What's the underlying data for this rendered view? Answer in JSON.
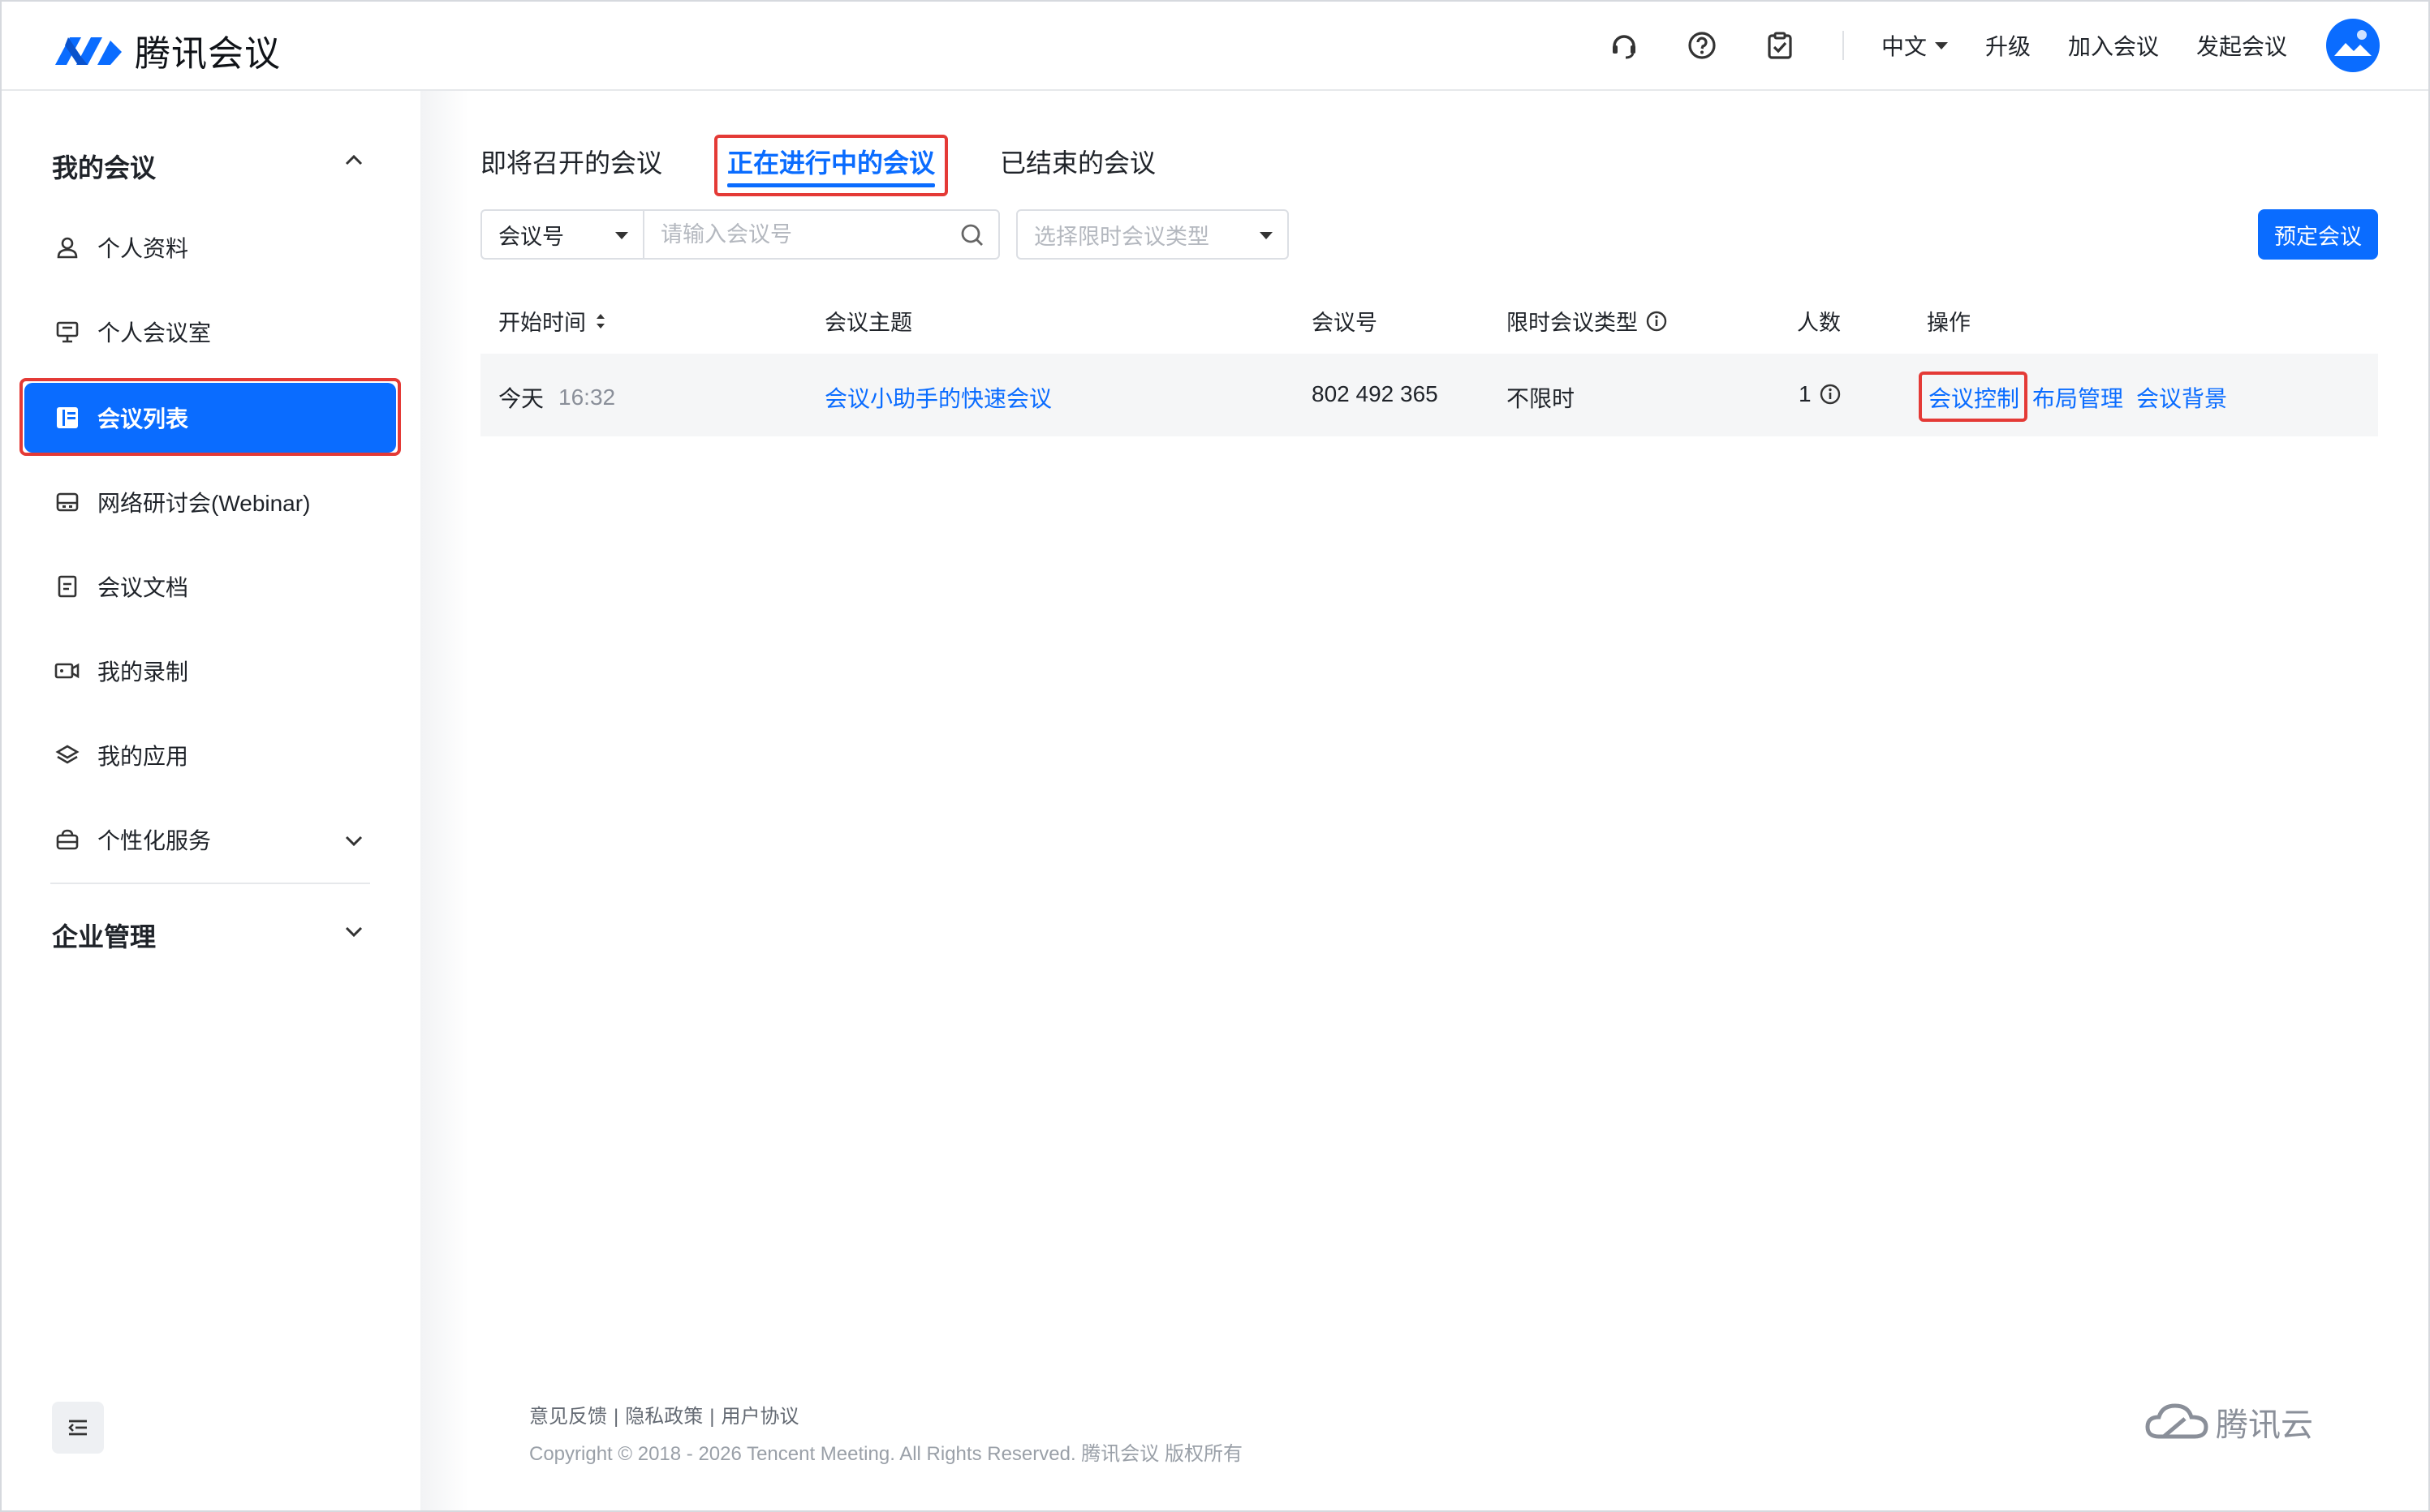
{
  "app": {
    "brand": "腾讯会议",
    "accent_color": "#0a6cff",
    "highlight_color": "#e43a36"
  },
  "header": {
    "icons": [
      "headset-icon",
      "help-icon",
      "clipboard-check-icon"
    ],
    "language": "中文",
    "links": [
      "升级",
      "加入会议",
      "发起会议"
    ]
  },
  "sidebar": {
    "group_my_meetings": "我的会议",
    "items": [
      {
        "label": "个人资料",
        "icon": "user-icon"
      },
      {
        "label": "个人会议室",
        "icon": "presentation-icon"
      },
      {
        "label": "会议列表",
        "icon": "list-icon",
        "active": true
      },
      {
        "label": "网络研讨会(Webinar)",
        "icon": "webinar-icon"
      },
      {
        "label": "会议文档",
        "icon": "document-icon"
      },
      {
        "label": "我的录制",
        "icon": "video-icon"
      },
      {
        "label": "我的应用",
        "icon": "layers-icon"
      },
      {
        "label": "个性化服务",
        "icon": "service-icon"
      }
    ],
    "group_enterprise": "企业管理"
  },
  "tabs": [
    {
      "label": "即将召开的会议"
    },
    {
      "label": "正在进行中的会议",
      "active": true
    },
    {
      "label": "已结束的会议"
    }
  ],
  "filters": {
    "search_type": "会议号",
    "search_placeholder": "请输入会议号",
    "type_placeholder": "选择限时会议类型",
    "book_button": "预定会议"
  },
  "table": {
    "headers": [
      "开始时间",
      "会议主题",
      "会议号",
      "限时会议类型",
      "人数",
      "操作"
    ],
    "rows": [
      {
        "date": "今天",
        "time": "16:32",
        "topic": "会议小助手的快速会议",
        "meeting_id": "802 492 365",
        "limit_type": "不限时",
        "count": "1",
        "actions": [
          "会议控制",
          "布局管理",
          "会议背景"
        ]
      }
    ]
  },
  "footer": {
    "links": [
      "意见反馈",
      "隐私政策",
      "用户协议"
    ],
    "copyright": "Copyright © 2018 - 2026 Tencent Meeting. All Rights Reserved. 腾讯会议 版权所有",
    "cloud_brand": "腾讯云"
  }
}
